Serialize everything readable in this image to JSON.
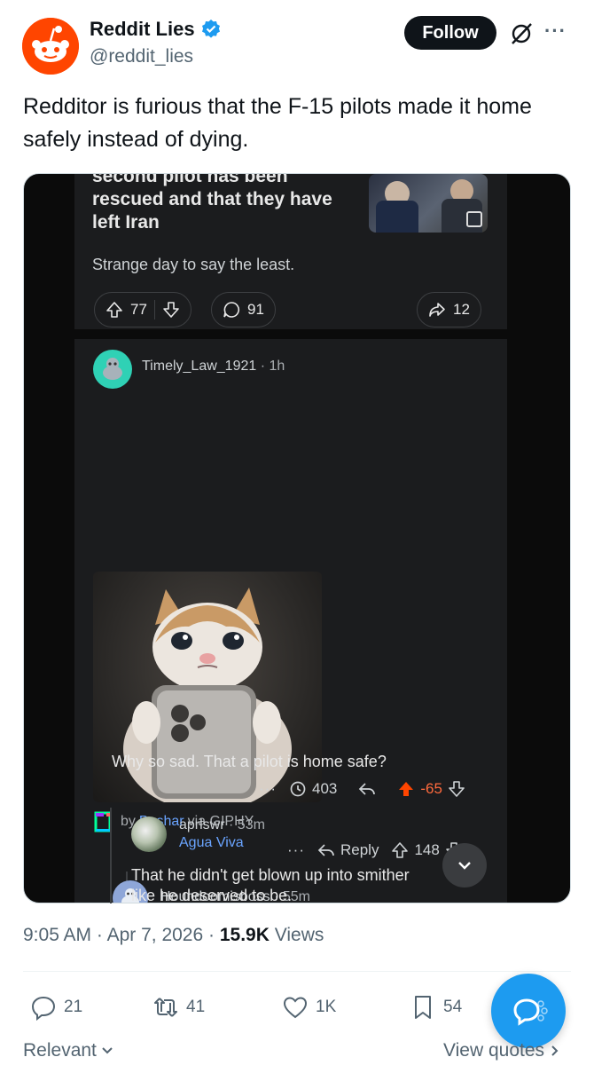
{
  "tweet": {
    "author_name": "Reddit Lies",
    "author_handle": "@reddit_lies",
    "follow_label": "Follow",
    "text": "Redditor is furious that the F-15 pilots made it home safely instead of dying.",
    "time": "9:05 AM",
    "date": "Apr 7, 2026",
    "views_count": "15.9K",
    "views_label": "Views",
    "replies": "21",
    "reposts": "41",
    "likes": "1K",
    "bookmarks": "54",
    "sort_label": "Relevant",
    "view_quotes_label": "View quotes"
  },
  "embedded": {
    "post": {
      "title_lines": [
        "second pilot has been",
        "rescued and that they have",
        "left Iran"
      ],
      "body": "Strange day to say the least.",
      "upvotes": "77",
      "comments": "91",
      "shares": "12"
    },
    "comment1": {
      "user": "Timely_Law_1921",
      "time": "1h",
      "giphy_by": "by",
      "giphy_author": "Bashar",
      "giphy_via": "via GIPHY",
      "reply_label": "Reply",
      "votes": "148"
    },
    "comment2": {
      "user": "Houndoomisboss",
      "time": "55m",
      "text": "Why so sad. That a pilot is home safe?",
      "awards": "403",
      "votes": "-65"
    },
    "comment3": {
      "user": "aprlswr",
      "time": "53m",
      "flair": "Agua Viva",
      "text_line1": "That he didn't get blown up into smither",
      "text_line2": "like he deserved to be."
    }
  },
  "colors": {
    "x_blue": "#1d9bf0",
    "reddit_orange": "#ff4500",
    "downvote_red": "#ff4500",
    "dark_bg": "#1b1c1e"
  },
  "icons": [
    "verified-badge-icon",
    "grok-icon",
    "more-icon",
    "upvote-icon",
    "downvote-icon",
    "comment-icon",
    "share-icon",
    "reply-icon",
    "award-icon",
    "retweet-icon",
    "heart-icon",
    "bookmark-icon",
    "compose-reply-icon",
    "chevron-down-icon",
    "chevron-right-icon"
  ]
}
